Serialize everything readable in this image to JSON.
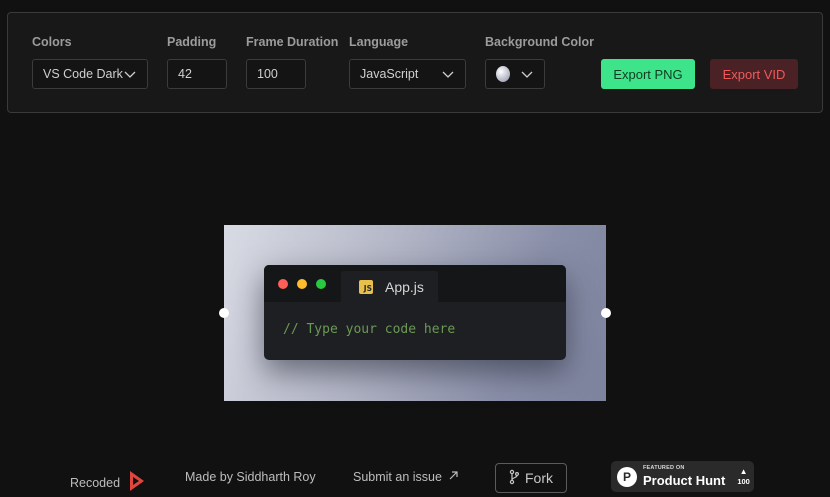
{
  "toolbar": {
    "colors": {
      "label": "Colors",
      "value": "VS Code Dark"
    },
    "padding": {
      "label": "Padding",
      "value": "42"
    },
    "frame_duration": {
      "label": "Frame Duration",
      "value": "100"
    },
    "language": {
      "label": "Language",
      "value": "JavaScript"
    },
    "background_color": {
      "label": "Background Color",
      "swatch_icon": "color-swatch-icon"
    },
    "export_png_label": "Export PNG",
    "export_vid_label": "Export VID"
  },
  "editor": {
    "tab_label": "App.js",
    "tab_icon_text": "JS",
    "code_line": "// Type your code here"
  },
  "footer": {
    "recoded_label": "Recoded",
    "made_by": "Made by Siddharth Roy",
    "submit_issue": "Submit an issue",
    "fork_label": "Fork",
    "product_hunt": {
      "featured_on": "FEATURED ON",
      "name": "Product Hunt",
      "logo_letter": "P",
      "upvote_arrow": "▲",
      "votes": "100"
    }
  },
  "colors": {
    "background": "#111111",
    "toolbar_bg": "#181818",
    "export_png": "#3ee48a",
    "export_vid_bg": "#4a2124",
    "export_vid_text": "#ef5a5a",
    "comment": "#6a9955",
    "traffic_red": "#ff5f57",
    "traffic_yellow": "#febc2e",
    "traffic_green": "#28c840"
  }
}
